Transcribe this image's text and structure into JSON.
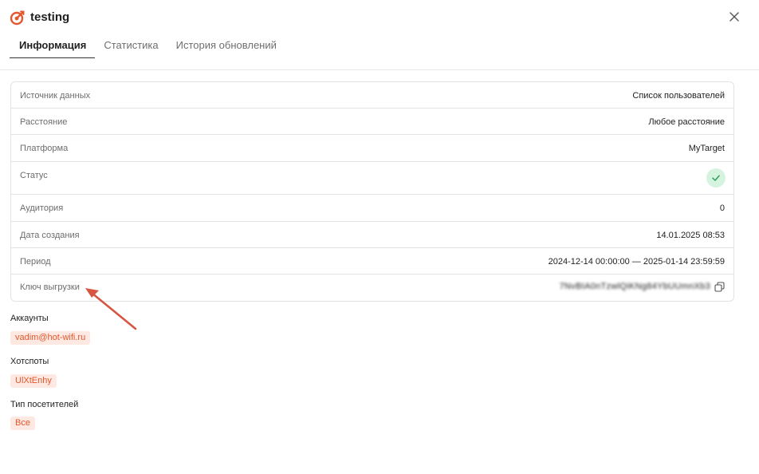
{
  "header": {
    "title": "testing",
    "tabs": [
      {
        "label": "Информация",
        "active": true
      },
      {
        "label": "Статистика",
        "active": false
      },
      {
        "label": "История обновлений",
        "active": false
      }
    ]
  },
  "info": {
    "rows": [
      {
        "label": "Источник данных",
        "value": "Список пользователей"
      },
      {
        "label": "Расстояние",
        "value": "Любое расстояние"
      },
      {
        "label": "Платформа",
        "value": "MyTarget"
      },
      {
        "label": "Статус",
        "value": ""
      },
      {
        "label": "Аудитория",
        "value": "0"
      },
      {
        "label": "Дата создания",
        "value": "14.01.2025 08:53"
      },
      {
        "label": "Период",
        "value": "2024-12-14 00:00:00 — 2025-01-14 23:59:59"
      },
      {
        "label": "Ключ выгрузки",
        "value": "7NvBIA0nTzwlQiKNg84YbUUmnXb3"
      }
    ]
  },
  "sections": {
    "accounts": {
      "label": "Аккаунты",
      "tags": [
        "vadim@hot-wifi.ru"
      ]
    },
    "hotspots": {
      "label": "Хотспоты",
      "tags": [
        "UlXtEnhy"
      ]
    },
    "visitor_type": {
      "label": "Тип посетителей",
      "tags": [
        "Все"
      ]
    }
  },
  "colors": {
    "accent": "#e4572e",
    "tag_bg": "#fde9e1",
    "status_ok_bg": "#d6f3df",
    "status_ok_check": "#2f9e5b",
    "annotation_arrow": "#d65543"
  },
  "icons": {
    "logo": "target-check-icon",
    "close": "close-icon",
    "status": "check-icon",
    "copy": "copy-icon"
  }
}
